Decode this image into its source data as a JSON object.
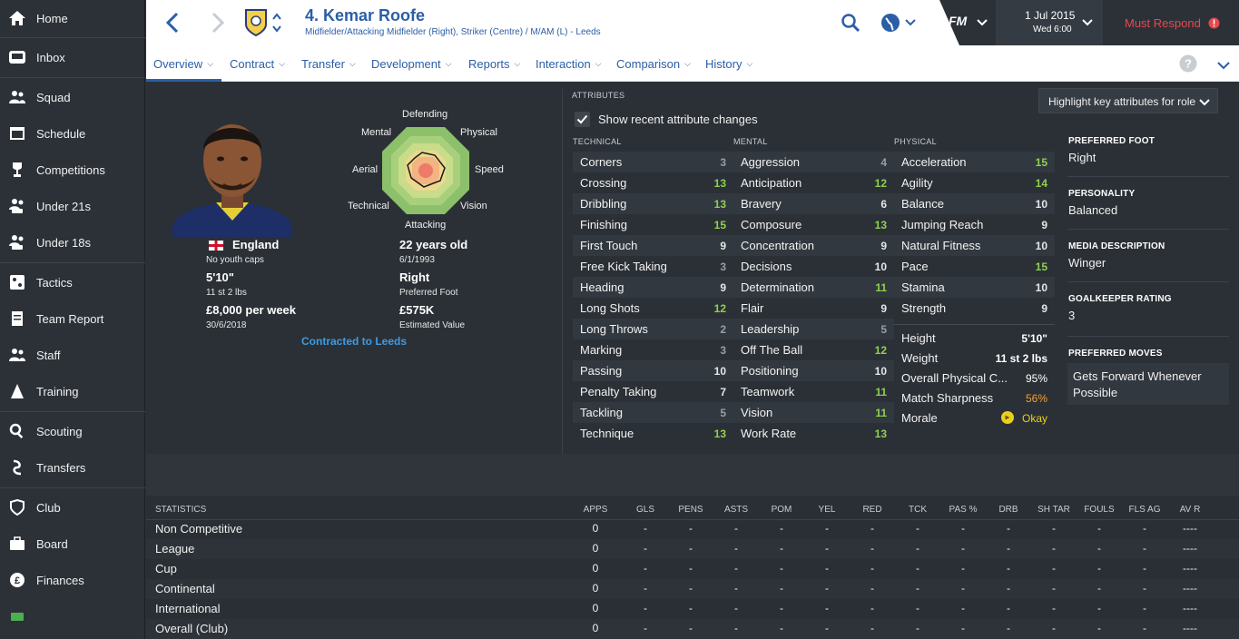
{
  "sidebar": {
    "items": [
      {
        "label": "Home",
        "icon": "home-icon"
      },
      {
        "label": "Inbox",
        "icon": "inbox-icon"
      },
      {
        "label": "Squad",
        "icon": "squad-icon"
      },
      {
        "label": "Schedule",
        "icon": "calendar-icon"
      },
      {
        "label": "Competitions",
        "icon": "trophy-icon"
      },
      {
        "label": "Under 21s",
        "icon": "u21-icon"
      },
      {
        "label": "Under 18s",
        "icon": "u18-icon"
      },
      {
        "label": "Tactics",
        "icon": "tactics-icon"
      },
      {
        "label": "Team Report",
        "icon": "report-icon"
      },
      {
        "label": "Staff",
        "icon": "staff-icon"
      },
      {
        "label": "Training",
        "icon": "training-icon"
      },
      {
        "label": "Scouting",
        "icon": "scouting-icon"
      },
      {
        "label": "Transfers",
        "icon": "transfers-icon"
      },
      {
        "label": "Club",
        "icon": "club-icon"
      },
      {
        "label": "Board",
        "icon": "board-icon"
      },
      {
        "label": "Finances",
        "icon": "finances-icon"
      }
    ]
  },
  "header": {
    "player_title": "4. Kemar Roofe",
    "player_subtitle": "Midfielder/Attacking Midfielder (Right), Striker (Centre) / M/AM (L) - Leeds",
    "date": "1 Jul 2015",
    "time": "Wed 6:00",
    "fm_label": "FM",
    "must_respond": "Must Respond"
  },
  "tabs": [
    {
      "label": "Overview"
    },
    {
      "label": "Contract"
    },
    {
      "label": "Transfer"
    },
    {
      "label": "Development"
    },
    {
      "label": "Reports"
    },
    {
      "label": "Interaction"
    },
    {
      "label": "Comparison"
    },
    {
      "label": "History"
    }
  ],
  "profile": {
    "nation": "England",
    "youth_caps": "No youth caps",
    "height": "5'10\"",
    "weight": "11 st 2 lbs",
    "wage": "£8,000 per week",
    "contract_end": "30/6/2018",
    "age": "22 years old",
    "dob": "6/1/1993",
    "foot": "Right",
    "foot_label": "Preferred Foot",
    "value": "£575K",
    "value_label": "Estimated Value",
    "contracted": "Contracted to Leeds"
  },
  "radar": {
    "labels": {
      "defending": "Defending",
      "physical": "Physical",
      "speed": "Speed",
      "vision": "Vision",
      "attacking": "Attacking",
      "technical": "Technical",
      "aerial": "Aerial",
      "mental": "Mental"
    }
  },
  "attributes": {
    "heading": "ATTRIBUTES",
    "show_changes": "Show recent attribute changes",
    "highlight_button": "Highlight key attributes for role",
    "technical_heading": "TECHNICAL",
    "mental_heading": "MENTAL",
    "physical_heading": "PHYSICAL",
    "technical": [
      {
        "name": "Corners",
        "value": "3"
      },
      {
        "name": "Crossing",
        "value": "13"
      },
      {
        "name": "Dribbling",
        "value": "13"
      },
      {
        "name": "Finishing",
        "value": "15"
      },
      {
        "name": "First Touch",
        "value": "9"
      },
      {
        "name": "Free Kick Taking",
        "value": "3"
      },
      {
        "name": "Heading",
        "value": "9"
      },
      {
        "name": "Long Shots",
        "value": "12"
      },
      {
        "name": "Long Throws",
        "value": "2"
      },
      {
        "name": "Marking",
        "value": "3"
      },
      {
        "name": "Passing",
        "value": "10"
      },
      {
        "name": "Penalty Taking",
        "value": "7"
      },
      {
        "name": "Tackling",
        "value": "5"
      },
      {
        "name": "Technique",
        "value": "13"
      }
    ],
    "mental": [
      {
        "name": "Aggression",
        "value": "4"
      },
      {
        "name": "Anticipation",
        "value": "12"
      },
      {
        "name": "Bravery",
        "value": "6"
      },
      {
        "name": "Composure",
        "value": "13"
      },
      {
        "name": "Concentration",
        "value": "9"
      },
      {
        "name": "Decisions",
        "value": "10"
      },
      {
        "name": "Determination",
        "value": "11"
      },
      {
        "name": "Flair",
        "value": "9"
      },
      {
        "name": "Leadership",
        "value": "5"
      },
      {
        "name": "Off The Ball",
        "value": "12"
      },
      {
        "name": "Positioning",
        "value": "10"
      },
      {
        "name": "Teamwork",
        "value": "11"
      },
      {
        "name": "Vision",
        "value": "11"
      },
      {
        "name": "Work Rate",
        "value": "13"
      }
    ],
    "physical": [
      {
        "name": "Acceleration",
        "value": "15"
      },
      {
        "name": "Agility",
        "value": "14"
      },
      {
        "name": "Balance",
        "value": "10"
      },
      {
        "name": "Jumping Reach",
        "value": "9"
      },
      {
        "name": "Natural Fitness",
        "value": "10"
      },
      {
        "name": "Pace",
        "value": "15"
      },
      {
        "name": "Stamina",
        "value": "10"
      },
      {
        "name": "Strength",
        "value": "9"
      }
    ],
    "extra": [
      {
        "name": "Height",
        "value": "5'10\""
      },
      {
        "name": "Weight",
        "value": "11 st 2 lbs"
      },
      {
        "name": "Overall Physical C...",
        "value": "95%"
      },
      {
        "name": "Match Sharpness",
        "value": "56%"
      },
      {
        "name": "Morale",
        "value": "Okay"
      }
    ]
  },
  "info": {
    "foot_heading": "PREFERRED FOOT",
    "foot_value": "Right",
    "personality_heading": "PERSONALITY",
    "personality_value": "Balanced",
    "media_heading": "MEDIA DESCRIPTION",
    "media_value": "Winger",
    "gk_heading": "GOALKEEPER RATING",
    "gk_value": "3",
    "moves_heading": "PREFERRED MOVES",
    "moves_value": "Gets Forward Whenever Possible"
  },
  "statistics": {
    "heading": "STATISTICS",
    "columns": [
      "APPS",
      "GLS",
      "PENS",
      "ASTS",
      "POM",
      "YEL",
      "RED",
      "TCK",
      "PAS %",
      "DRB",
      "SH TAR",
      "FOULS",
      "FLS AG",
      "AV R"
    ],
    "rows": [
      {
        "label": "Non Competitive",
        "cells": [
          "0",
          "-",
          "-",
          "-",
          "-",
          "-",
          "-",
          "-",
          "-",
          "-",
          "-",
          "-",
          "-",
          "----"
        ]
      },
      {
        "label": "League",
        "cells": [
          "0",
          "-",
          "-",
          "-",
          "-",
          "-",
          "-",
          "-",
          "-",
          "-",
          "-",
          "-",
          "-",
          "----"
        ]
      },
      {
        "label": "Cup",
        "cells": [
          "0",
          "-",
          "-",
          "-",
          "-",
          "-",
          "-",
          "-",
          "-",
          "-",
          "-",
          "-",
          "-",
          "----"
        ]
      },
      {
        "label": "Continental",
        "cells": [
          "0",
          "-",
          "-",
          "-",
          "-",
          "-",
          "-",
          "-",
          "-",
          "-",
          "-",
          "-",
          "-",
          "----"
        ]
      },
      {
        "label": "International",
        "cells": [
          "0",
          "-",
          "-",
          "-",
          "-",
          "-",
          "-",
          "-",
          "-",
          "-",
          "-",
          "-",
          "-",
          "----"
        ]
      },
      {
        "label": "Overall (Club)",
        "cells": [
          "0",
          "-",
          "-",
          "-",
          "-",
          "-",
          "-",
          "-",
          "-",
          "-",
          "-",
          "-",
          "-",
          "----"
        ]
      }
    ]
  },
  "colors": {
    "accent": "#2b5ea7",
    "alert": "#e5484d",
    "good": "#8fd14f",
    "warn": "#f0a030",
    "sidebar": "#2c3138"
  }
}
